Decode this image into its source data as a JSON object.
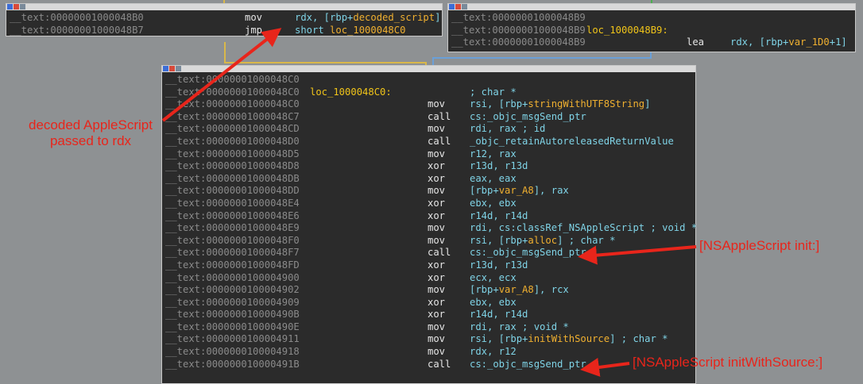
{
  "panels": {
    "left": {
      "rows": [
        {
          "addr": "__text:00000001000048B0",
          "mnemonic": "mov",
          "op_pre": "rdx, [rbp+",
          "op_hl": "decoded_script",
          "op_post": "]"
        },
        {
          "addr": "__text:00000001000048B7",
          "mnemonic": "jmp",
          "op_pre": "short ",
          "op_hl": "loc_1000048C0",
          "op_post": ""
        }
      ]
    },
    "right": {
      "rows": [
        {
          "addr": "__text:00000001000048B9",
          "label": "",
          "mnemonic": "",
          "op_pre": "",
          "op_hl": "",
          "op_post": ""
        },
        {
          "addr": "__text:00000001000048B9",
          "label": "loc_1000048B9:",
          "mnemonic": "",
          "op_pre": "",
          "op_hl": "",
          "op_post": ""
        },
        {
          "addr": "__text:00000001000048B9",
          "label": "",
          "mnemonic": "lea",
          "op_pre": "rdx, [rbp+",
          "op_hl": "var_1D0",
          "op_post": "+1]"
        }
      ]
    },
    "main": {
      "rows": [
        {
          "addr": "__text:00000001000048C0",
          "label": "",
          "mnemonic": "",
          "op_pre": "",
          "op_hl": "",
          "op_post": ""
        },
        {
          "addr": "__text:00000001000048C0",
          "label": "loc_1000048C0:",
          "mnemonic": "",
          "op_pre": "; char *",
          "op_hl": "",
          "op_post": ""
        },
        {
          "addr": "__text:00000001000048C0",
          "label": "",
          "mnemonic": "mov",
          "op_pre": "rsi, [rbp+",
          "op_hl": "stringWithUTF8String",
          "op_post": "]"
        },
        {
          "addr": "__text:00000001000048C7",
          "label": "",
          "mnemonic": "call",
          "op_pre": "cs:_objc_msgSend_ptr",
          "op_hl": "",
          "op_post": ""
        },
        {
          "addr": "__text:00000001000048CD",
          "label": "",
          "mnemonic": "mov",
          "op_pre": "rdi, rax ; id",
          "op_hl": "",
          "op_post": ""
        },
        {
          "addr": "__text:00000001000048D0",
          "label": "",
          "mnemonic": "call",
          "op_pre": "_objc_retainAutoreleasedReturnValue",
          "op_hl": "",
          "op_post": ""
        },
        {
          "addr": "__text:00000001000048D5",
          "label": "",
          "mnemonic": "mov",
          "op_pre": "r12, rax",
          "op_hl": "",
          "op_post": ""
        },
        {
          "addr": "__text:00000001000048D8",
          "label": "",
          "mnemonic": "xor",
          "op_pre": "r13d, r13d",
          "op_hl": "",
          "op_post": ""
        },
        {
          "addr": "__text:00000001000048DB",
          "label": "",
          "mnemonic": "xor",
          "op_pre": "eax, eax",
          "op_hl": "",
          "op_post": ""
        },
        {
          "addr": "__text:00000001000048DD",
          "label": "",
          "mnemonic": "mov",
          "op_pre": "[rbp+",
          "op_hl": "var_A8",
          "op_post": "], rax"
        },
        {
          "addr": "__text:00000001000048E4",
          "label": "",
          "mnemonic": "xor",
          "op_pre": "ebx, ebx",
          "op_hl": "",
          "op_post": ""
        },
        {
          "addr": "__text:00000001000048E6",
          "label": "",
          "mnemonic": "xor",
          "op_pre": "r14d, r14d",
          "op_hl": "",
          "op_post": ""
        },
        {
          "addr": "__text:00000001000048E9",
          "label": "",
          "mnemonic": "mov",
          "op_pre": "rdi, cs:classRef_NSAppleScript ; void *",
          "op_hl": "",
          "op_post": ""
        },
        {
          "addr": "__text:00000001000048F0",
          "label": "",
          "mnemonic": "mov",
          "op_pre": "rsi, [rbp+",
          "op_hl": "alloc",
          "op_post": "] ; char *"
        },
        {
          "addr": "__text:00000001000048F7",
          "label": "",
          "mnemonic": "call",
          "op_pre": "cs:_objc_msgSend_ptr",
          "op_hl": "",
          "op_post": ""
        },
        {
          "addr": "__text:00000001000048FD",
          "label": "",
          "mnemonic": "xor",
          "op_pre": "r13d, r13d",
          "op_hl": "",
          "op_post": ""
        },
        {
          "addr": "__text:0000000100004900",
          "label": "",
          "mnemonic": "xor",
          "op_pre": "ecx, ecx",
          "op_hl": "",
          "op_post": ""
        },
        {
          "addr": "__text:0000000100004902",
          "label": "",
          "mnemonic": "mov",
          "op_pre": "[rbp+",
          "op_hl": "var_A8",
          "op_post": "], rcx"
        },
        {
          "addr": "__text:0000000100004909",
          "label": "",
          "mnemonic": "xor",
          "op_pre": "ebx, ebx",
          "op_hl": "",
          "op_post": ""
        },
        {
          "addr": "__text:000000010000490B",
          "label": "",
          "mnemonic": "xor",
          "op_pre": "r14d, r14d",
          "op_hl": "",
          "op_post": ""
        },
        {
          "addr": "__text:000000010000490E",
          "label": "",
          "mnemonic": "mov",
          "op_pre": "rdi, rax ; void *",
          "op_hl": "",
          "op_post": ""
        },
        {
          "addr": "__text:0000000100004911",
          "label": "",
          "mnemonic": "mov",
          "op_pre": "rsi, [rbp+",
          "op_hl": "initWithSource",
          "op_post": "] ; char *"
        },
        {
          "addr": "__text:0000000100004918",
          "label": "",
          "mnemonic": "mov",
          "op_pre": "rdx, r12",
          "op_hl": "",
          "op_post": ""
        },
        {
          "addr": "__text:000000010000491B",
          "label": "",
          "mnemonic": "call",
          "op_pre": "cs:_objc_msgSend_ptr",
          "op_hl": "",
          "op_post": ""
        }
      ]
    }
  },
  "annotations": {
    "decoded_line1": "decoded AppleScript",
    "decoded_line2": "passed to rdx",
    "init": "[NSAppleScript init:]",
    "init_with_source": "[NSAppleScript initWithSource:]"
  },
  "colors": {
    "background": "#8e9193",
    "panel": "#2b2b2b",
    "address": "#8a8a8a",
    "label": "#f0c419",
    "operand": "#7fd3e6",
    "highlight": "#f0b030",
    "annotation": "#e8251b",
    "wire_yellow": "#d9b84a",
    "wire_blue": "#6aa0d8"
  }
}
